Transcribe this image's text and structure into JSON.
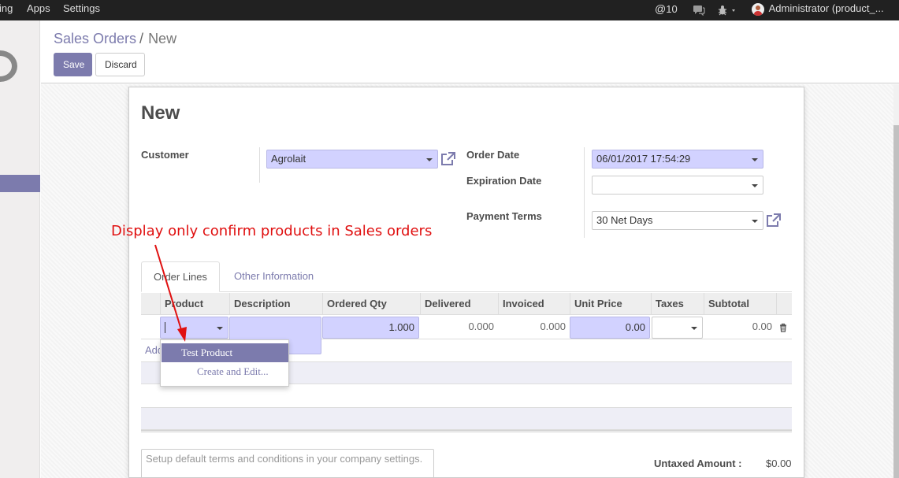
{
  "topbar": {
    "menu": [
      "ing",
      "Apps",
      "Settings"
    ],
    "mentions_count": "10",
    "user": "Administrator (product_..."
  },
  "breadcrumb": {
    "parent": "Sales Orders",
    "separator": "/",
    "current": "New"
  },
  "buttons": {
    "save": "Save",
    "discard": "Discard"
  },
  "form": {
    "title": "New",
    "customer_label": "Customer",
    "customer_value": "Agrolait",
    "order_date_label": "Order Date",
    "order_date_value": "06/01/2017 17:54:29",
    "expiration_date_label": "Expiration Date",
    "expiration_date_value": "",
    "payment_terms_label": "Payment Terms",
    "payment_terms_value": "30 Net Days"
  },
  "annotation": "Display only confirm products in Sales orders",
  "tabs": [
    "Order Lines",
    "Other Information"
  ],
  "table": {
    "headers": [
      "Product",
      "Description",
      "Ordered Qty",
      "Delivered",
      "Invoiced",
      "Unit Price",
      "Taxes",
      "Subtotal"
    ],
    "row": {
      "product": "",
      "description": "",
      "ordered_qty": "1.000",
      "delivered": "0.000",
      "invoiced": "0.000",
      "unit_price": "0.00",
      "taxes": "",
      "subtotal": "0.00"
    },
    "add_item": "Add"
  },
  "dropdown": {
    "items": [
      "Test Product",
      "Create and Edit..."
    ]
  },
  "notes_placeholder": "Setup default terms and conditions in your company settings.",
  "totals": {
    "untaxed_label": "Untaxed Amount :",
    "untaxed_value": "$0.00"
  },
  "colors": {
    "brand": "#7c7bad",
    "required_field": "#d2d2ff",
    "annotation": "#e01010",
    "topbar": "#212121"
  }
}
